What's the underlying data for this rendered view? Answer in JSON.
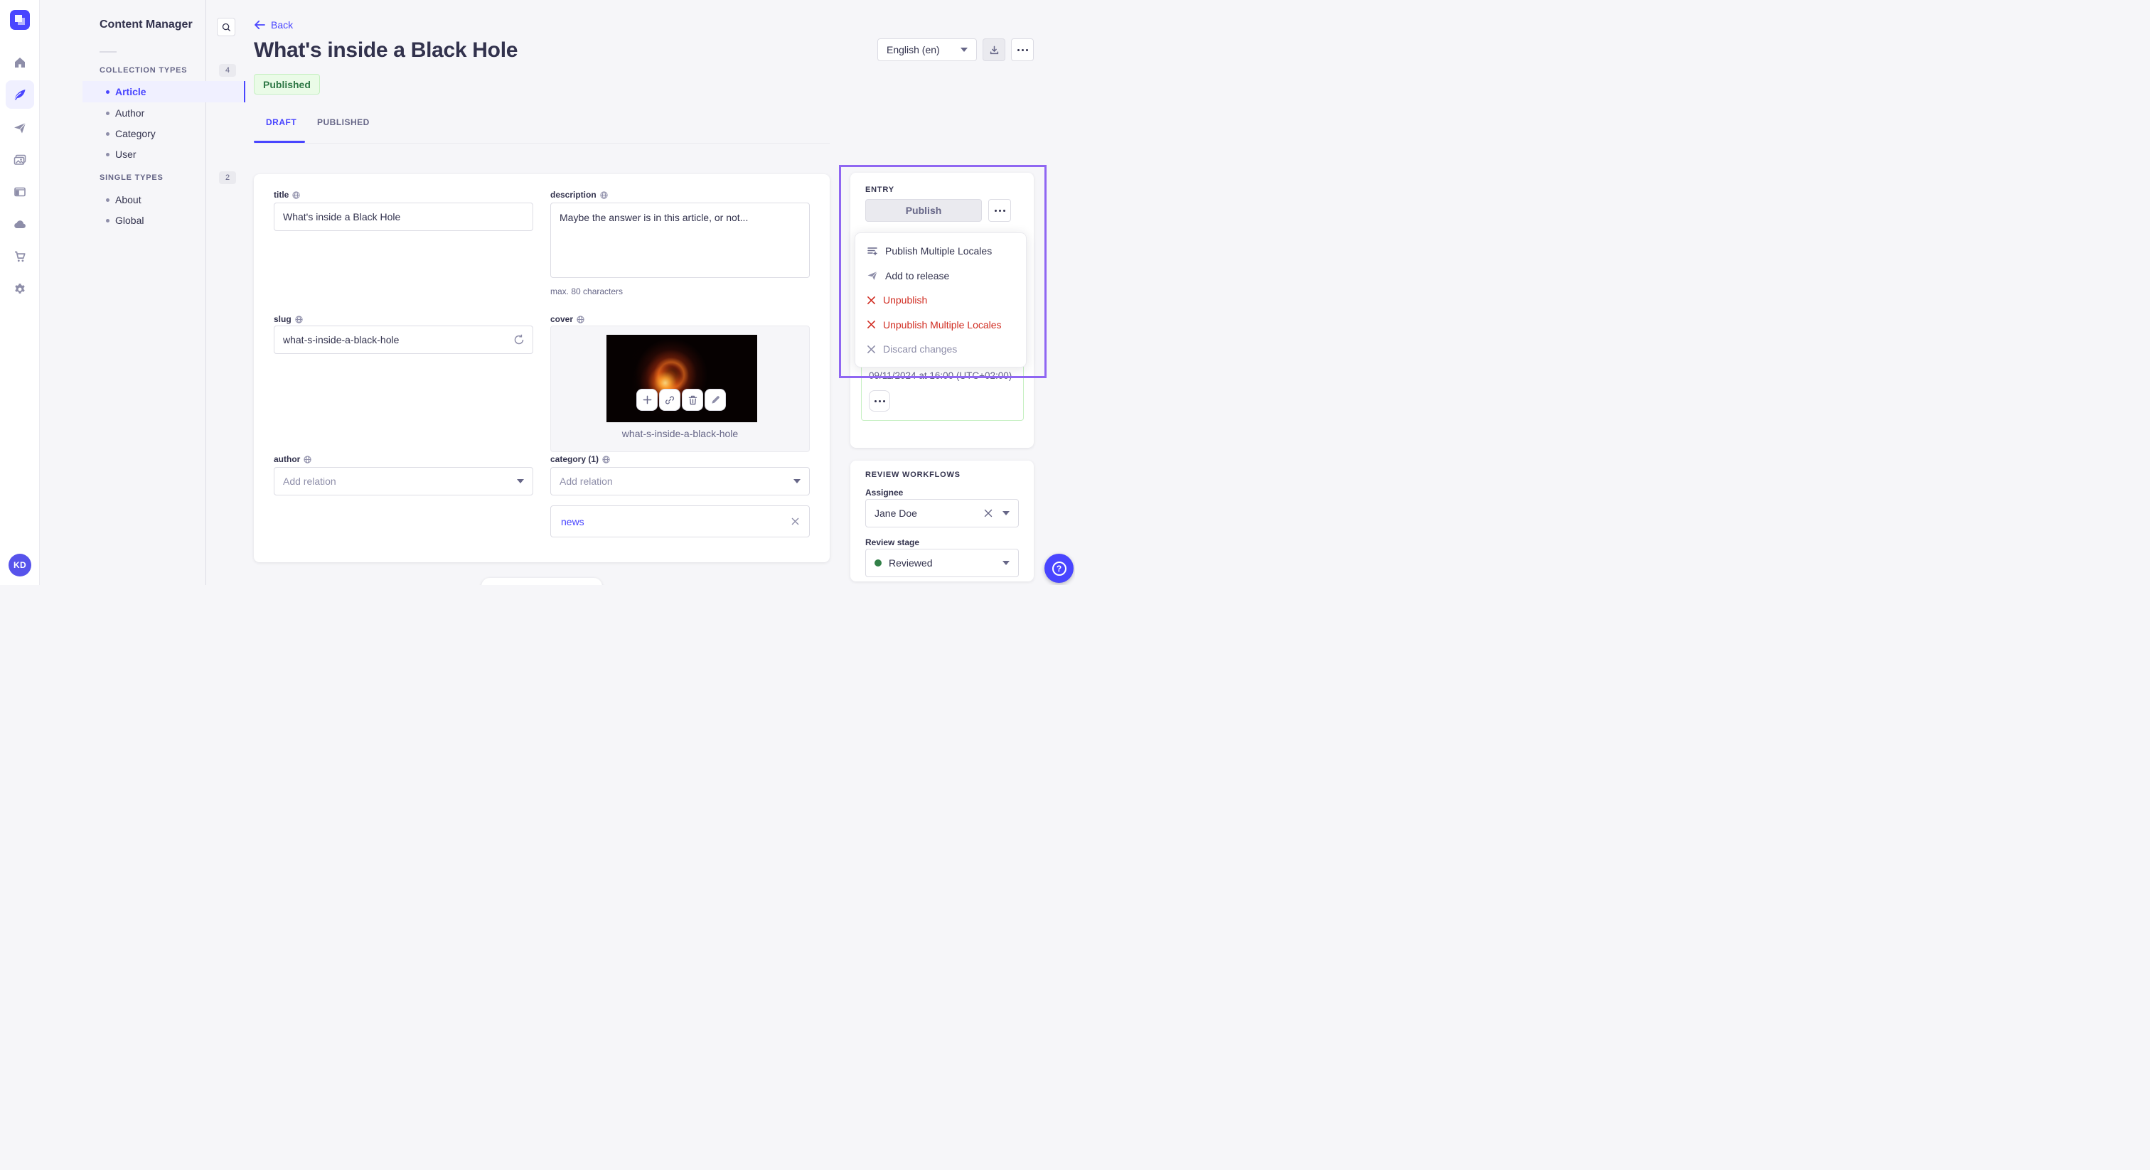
{
  "nav_rail": {
    "avatar_initials": "KD",
    "items": [
      {
        "name": "home"
      },
      {
        "name": "content-manager",
        "active": true
      },
      {
        "name": "releases"
      },
      {
        "name": "media-library"
      },
      {
        "name": "content-type-builder"
      },
      {
        "name": "cloud"
      },
      {
        "name": "marketplace"
      },
      {
        "name": "settings"
      }
    ]
  },
  "sidebar": {
    "title": "Content Manager",
    "sections": [
      {
        "label": "COLLECTION TYPES",
        "count": "4",
        "items": [
          {
            "label": "Article",
            "active": true
          },
          {
            "label": "Author"
          },
          {
            "label": "Category"
          },
          {
            "label": "User"
          }
        ]
      },
      {
        "label": "SINGLE TYPES",
        "count": "2",
        "items": [
          {
            "label": "About"
          },
          {
            "label": "Global"
          }
        ]
      }
    ]
  },
  "header": {
    "back_label": "Back",
    "title": "What's inside a Black Hole",
    "status_badge": "Published",
    "locale_select": "English (en)"
  },
  "tabs": {
    "draft": "DRAFT",
    "published": "PUBLISHED"
  },
  "form": {
    "title": {
      "label": "title",
      "value": "What's inside a Black Hole"
    },
    "description": {
      "label": "description",
      "value": "Maybe the answer is in this article, or not...",
      "helper": "max. 80 characters"
    },
    "slug": {
      "label": "slug",
      "value": "what-s-inside-a-black-hole"
    },
    "cover": {
      "label": "cover",
      "caption": "what-s-inside-a-black-hole"
    },
    "author": {
      "label": "author",
      "placeholder": "Add relation"
    },
    "category": {
      "label": "category (1)",
      "placeholder": "Add relation",
      "relation": "news"
    }
  },
  "entry_panel": {
    "title": "ENTRY",
    "publish_label": "Publish",
    "menu": [
      {
        "label": "Publish Multiple Locales",
        "icon": "list-plus"
      },
      {
        "label": "Add to release",
        "icon": "paper-plane"
      },
      {
        "label": "Unpublish",
        "icon": "cross-danger"
      },
      {
        "label": "Unpublish Multiple Locales",
        "icon": "cross-danger"
      },
      {
        "label": "Discard changes",
        "icon": "cross-muted"
      }
    ],
    "scheduled_date": "09/11/2024 at 16:00 (UTC+02:00)"
  },
  "review_panel": {
    "title": "REVIEW WORKFLOWS",
    "assignee_label": "Assignee",
    "assignee_value": "Jane Doe",
    "stage_label": "Review stage",
    "stage_value": "Reviewed"
  },
  "floating": {
    "help_label": "?"
  },
  "colors": {
    "primary": "#4945ff",
    "highlight": "#8f66f2",
    "success": "#328048",
    "danger": "#d02b20"
  }
}
